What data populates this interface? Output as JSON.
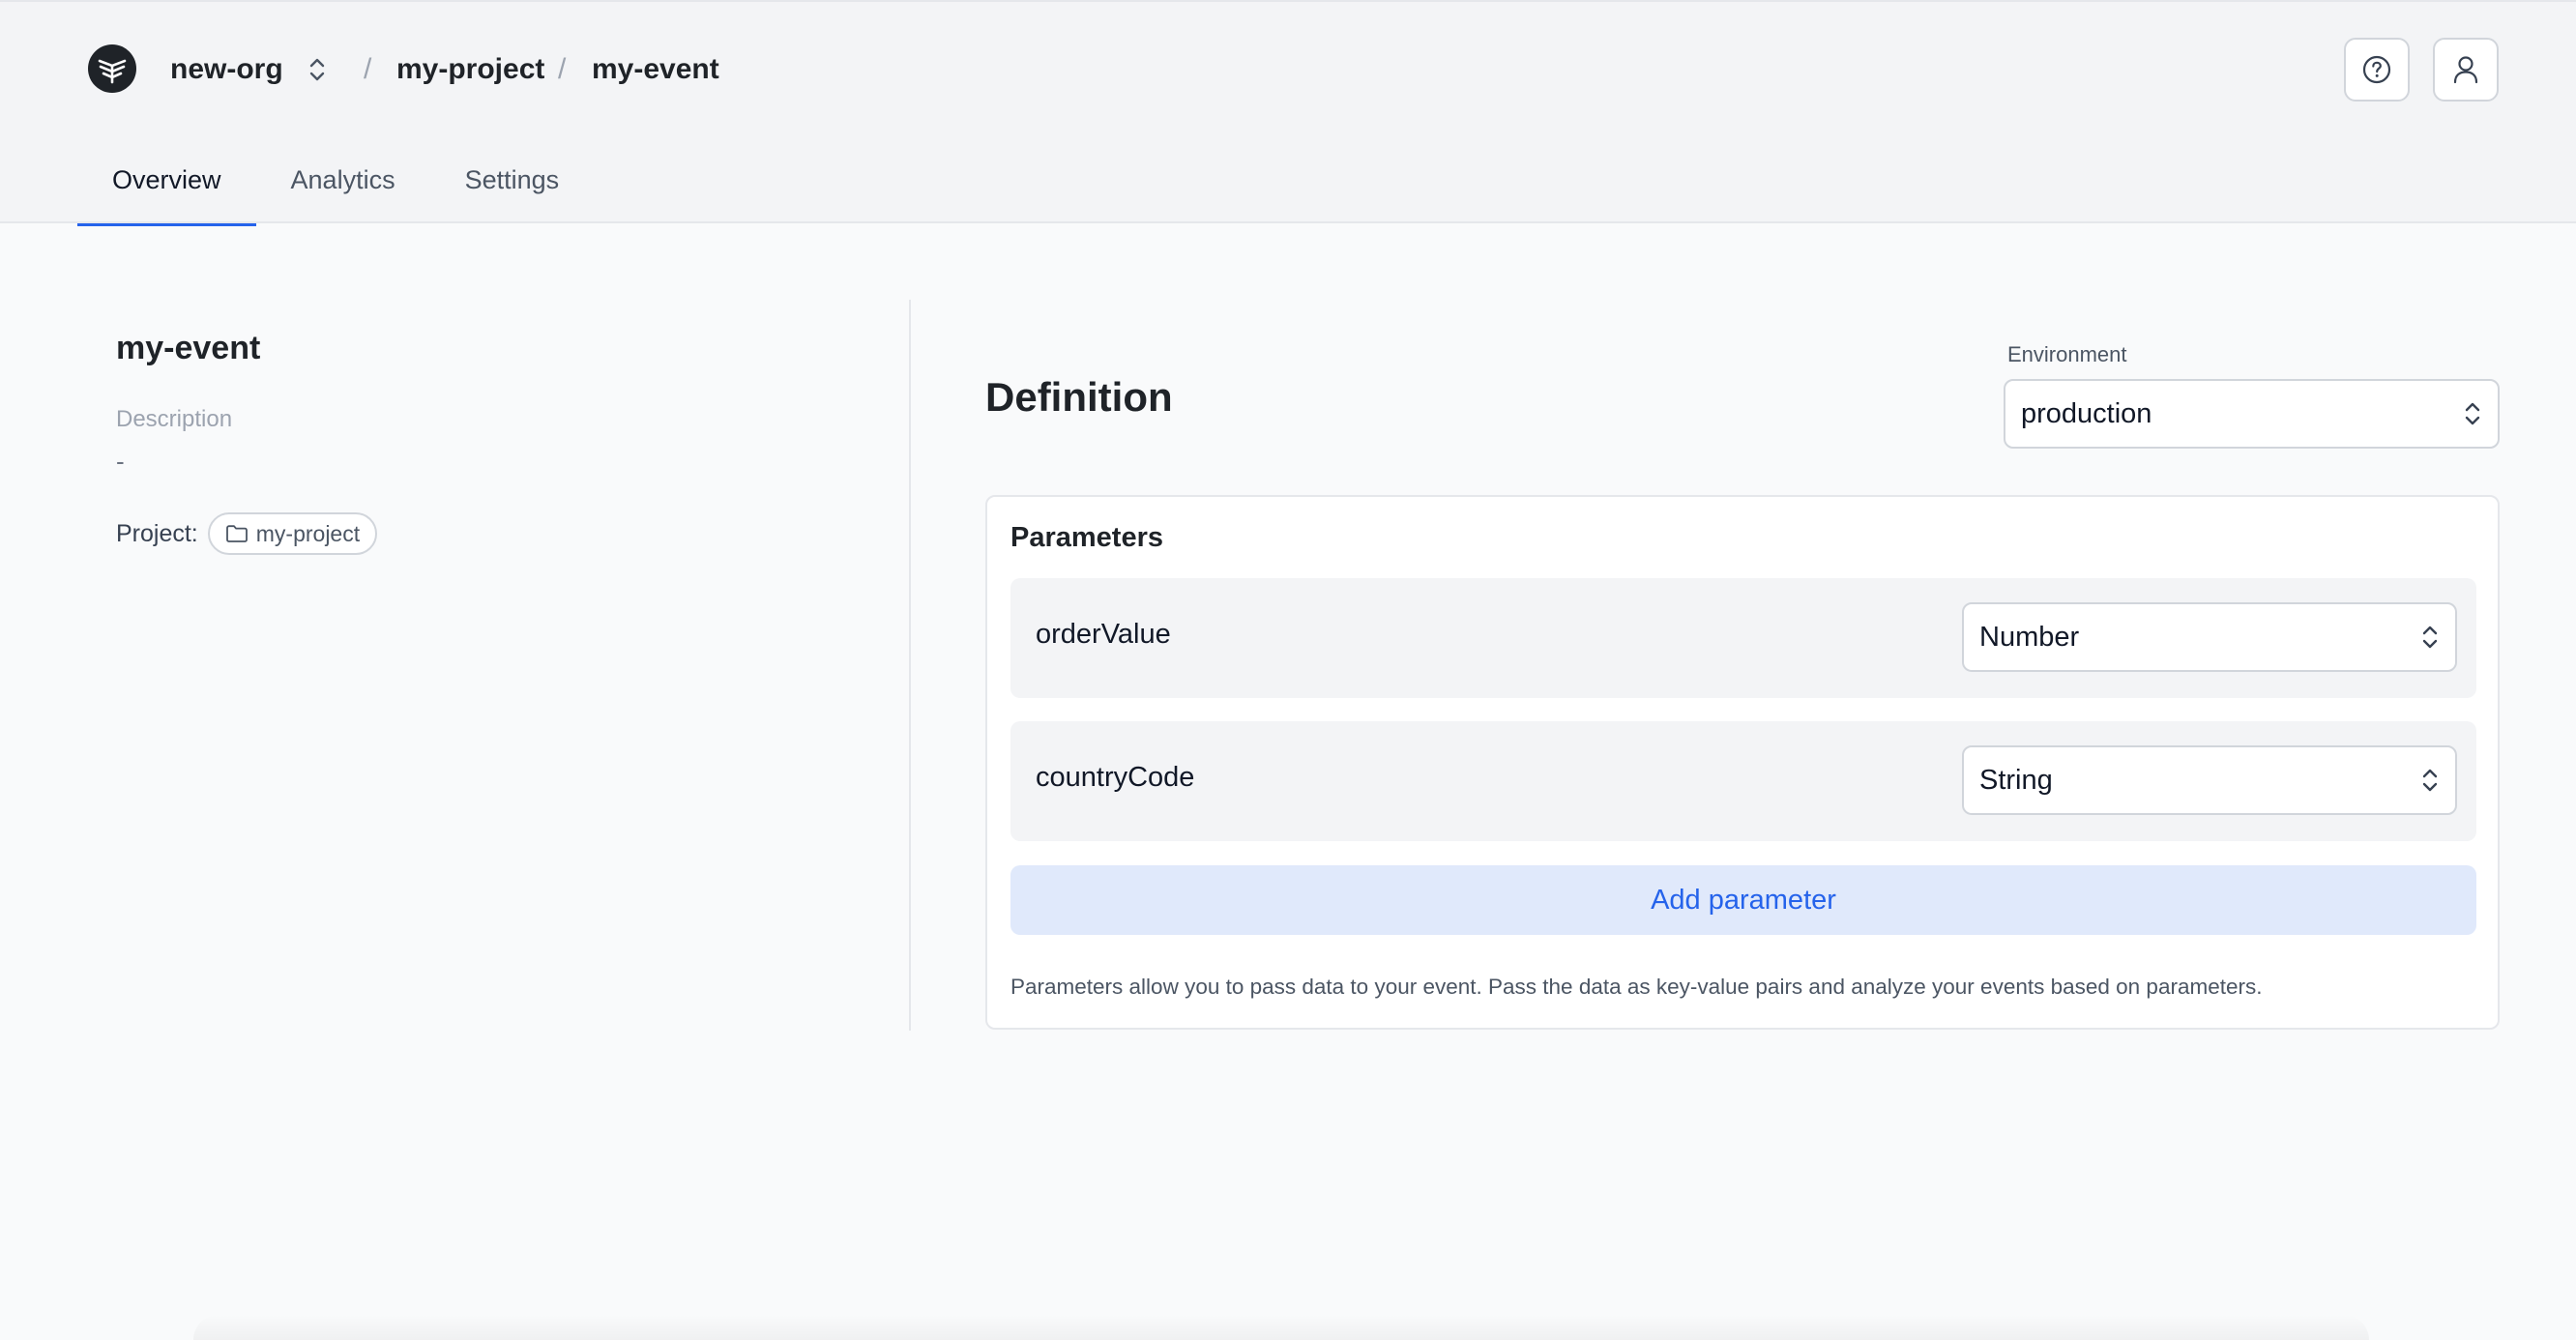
{
  "breadcrumb": {
    "org": "new-org",
    "separator": "/",
    "project": "my-project",
    "event": "my-event"
  },
  "header": {
    "help_icon": "question-circle-icon",
    "user_icon": "user-icon",
    "logo_icon": "app-logo"
  },
  "tabs": [
    {
      "label": "Overview",
      "active": true
    },
    {
      "label": "Analytics",
      "active": false
    },
    {
      "label": "Settings",
      "active": false
    }
  ],
  "event": {
    "title": "my-event",
    "description_label": "Description",
    "description_value": "-",
    "project_label": "Project:",
    "project_chip": "my-project",
    "project_chip_icon": "folder-icon"
  },
  "definition": {
    "title": "Definition",
    "environment_label": "Environment",
    "environment_value": "production",
    "parameters_title": "Parameters",
    "parameters": [
      {
        "name": "orderValue",
        "type": "Number"
      },
      {
        "name": "countryCode",
        "type": "String"
      }
    ],
    "add_parameter_label": "Add parameter",
    "note": "Parameters allow you to pass data to your event. Pass the data as key-value pairs and analyze your events based on parameters."
  },
  "colors": {
    "accent": "#2563eb",
    "add_button_bg": "#e0e9fb",
    "header_bg": "#f3f4f6",
    "page_bg": "#f9fafb"
  }
}
